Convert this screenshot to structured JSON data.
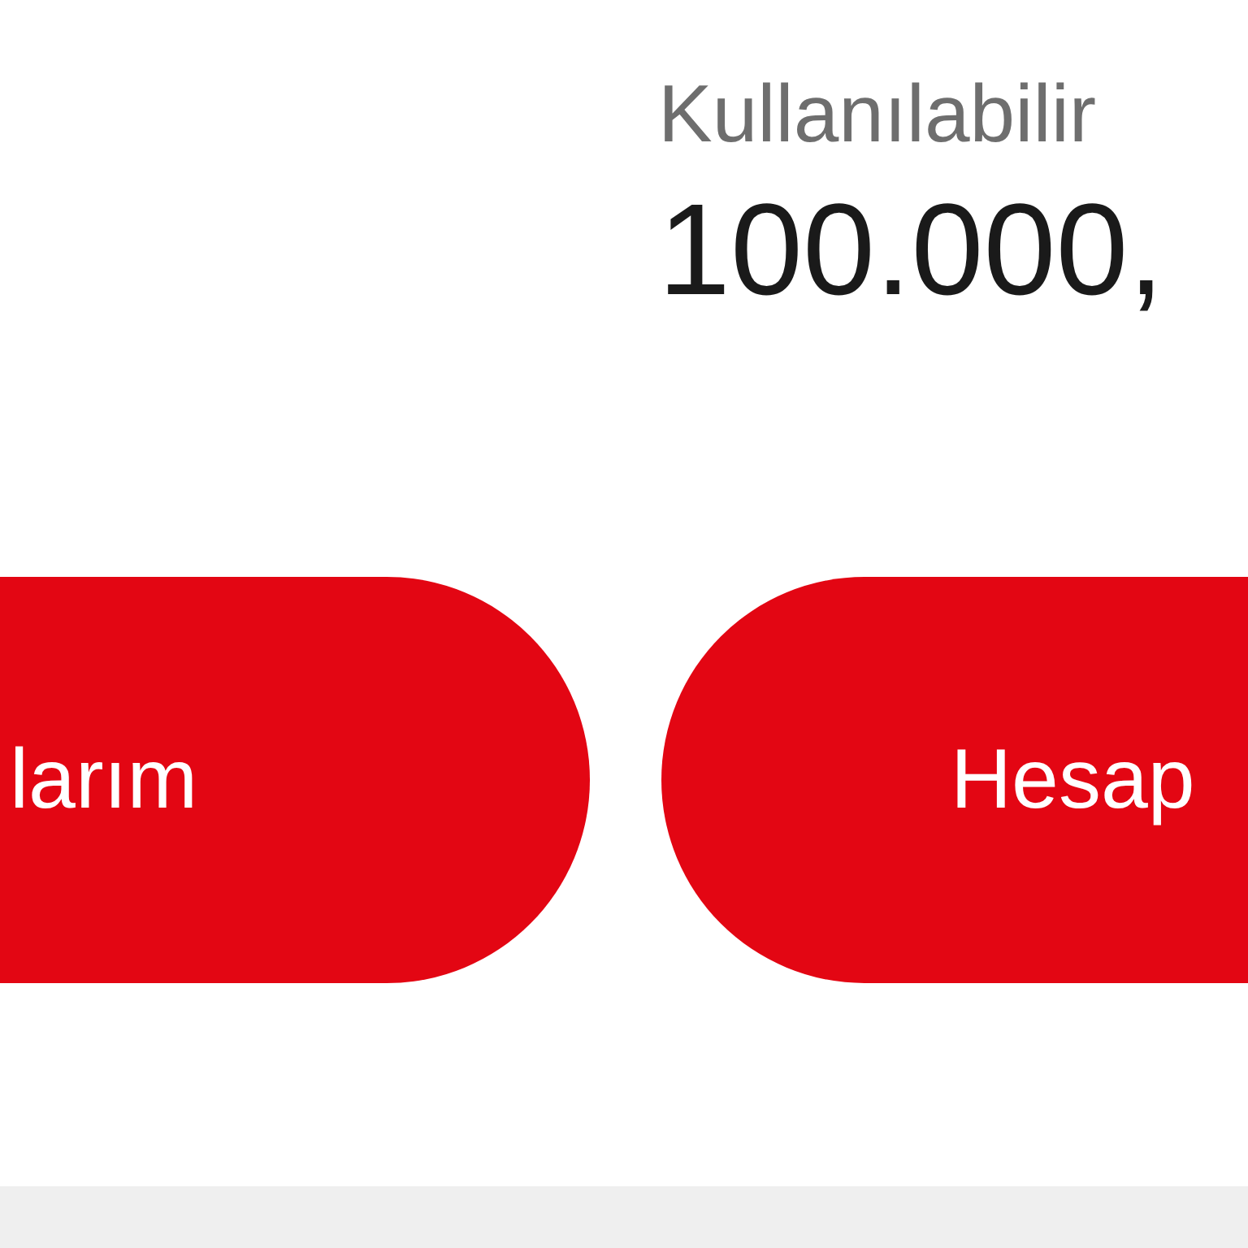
{
  "balance": {
    "label": "Kullanılabilir",
    "amount": "100.000,"
  },
  "buttons": [
    {
      "label": "larım"
    },
    {
      "label": "Hesap"
    }
  ]
}
